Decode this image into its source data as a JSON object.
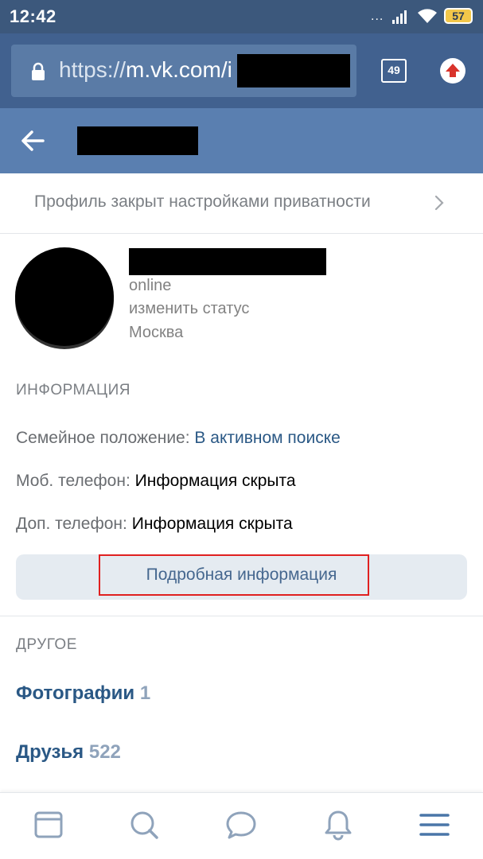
{
  "status_bar": {
    "time": "12:42",
    "dots": "...",
    "battery": "57"
  },
  "browser": {
    "url_scheme": "https://",
    "url_host": "m.vk.com",
    "url_path": "/i",
    "tabs_count": "49"
  },
  "privacy_notice": {
    "text": "Профиль закрыт настройками приватности"
  },
  "profile": {
    "online": "online",
    "status_link": "изменить статус",
    "city": "Москва"
  },
  "info": {
    "section_title": "ИНФОРМАЦИЯ",
    "rows": [
      {
        "label": "Семейное положение:",
        "value": "В активном поиске"
      },
      {
        "label": "Моб. телефон:",
        "value": "Информация скрыта"
      },
      {
        "label": "Доп. телефон:",
        "value": "Информация скрыта"
      }
    ],
    "more_button": "Подробная информация"
  },
  "other": {
    "section_title": "ДРУГОЕ",
    "items": [
      {
        "label": "Фотографии",
        "count": "1"
      },
      {
        "label": "Друзья",
        "count": "522"
      }
    ]
  },
  "colors": {
    "header_blue": "#5a7fb0",
    "link_blue": "#2a5885",
    "highlight_red": "#e02020"
  },
  "bottom_nav": {
    "icons": [
      "news-icon",
      "search-icon",
      "messages-icon",
      "notifications-icon",
      "menu-icon"
    ]
  }
}
